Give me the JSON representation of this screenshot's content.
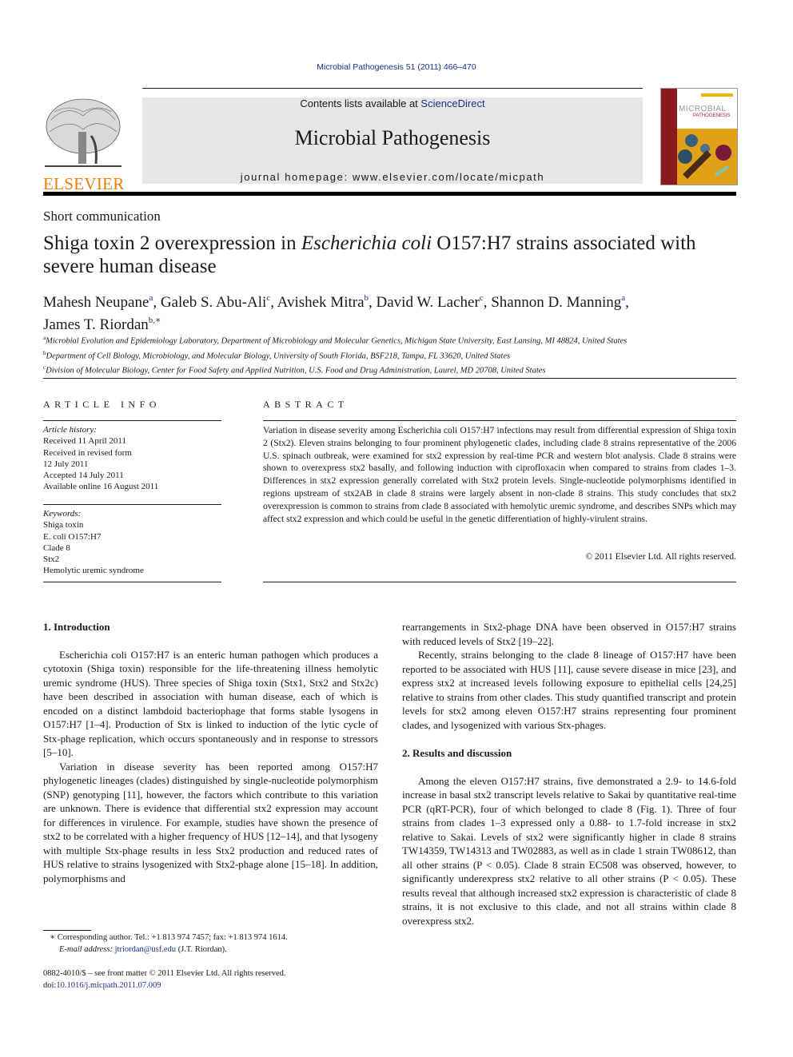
{
  "header": {
    "citation": "Microbial Pathogenesis 51 (2011) 466–470",
    "contents_prefix": "Contents lists available at ",
    "contents_link": "ScienceDirect",
    "journal_title": "Microbial Pathogenesis",
    "homepage": "journal homepage: www.elsevier.com/locate/micpath",
    "publisher_logo_text": "ELSEVIER",
    "cover_title_line1": "MICROBIAL",
    "cover_title_line2": "PATHOGENESIS",
    "colors": {
      "publisher_orange": "#f07d00",
      "link_blue": "#1e2f8a",
      "banner_gray": "#e6e6e6",
      "cover_red": "#8b1a1f"
    }
  },
  "article": {
    "section_type": "Short communication",
    "title_part1": "Shiga toxin 2 overexpression in ",
    "title_italic": "Escherichia coli",
    "title_part2": " O157:H7 strains associated with severe human disease",
    "authors": [
      {
        "name": "Mahesh Neupane",
        "sup": "a",
        "sep": ", "
      },
      {
        "name": "Galeb S. Abu-Ali",
        "sup": "c",
        "sep": ", "
      },
      {
        "name": "Avishek Mitra",
        "sup": "b",
        "sep": ", "
      },
      {
        "name": "David W. Lacher",
        "sup": "c",
        "sep": ", "
      },
      {
        "name": "Shannon D. Manning",
        "sup": "a",
        "sep": ","
      },
      {
        "name": "James T. Riordan",
        "sup": "b,∗",
        "sep": ""
      }
    ],
    "affiliations": [
      {
        "key": "a",
        "text": "Microbial Evolution and Epidemiology Laboratory, Department of Microbiology and Molecular Genetics, Michigan State University, East Lansing, MI 48824, United States"
      },
      {
        "key": "b",
        "text": "Department of Cell Biology, Microbiology, and Molecular Biology, University of South Florida, BSF218, Tampa, FL 33620, United States"
      },
      {
        "key": "c",
        "text": "Division of Molecular Biology, Center for Food Safety and Applied Nutrition, U.S. Food and Drug Administration, Laurel, MD 20708, United States"
      }
    ]
  },
  "article_info": {
    "heading": "ARTICLE INFO",
    "history_label": "Article history:",
    "history": [
      "Received 11 April 2011",
      "Received in revised form",
      "12 July 2011",
      "Accepted 14 July 2011",
      "Available online 16 August 2011"
    ],
    "keywords_label": "Keywords:",
    "keywords": [
      "Shiga toxin",
      "E. coli O157:H7",
      "Clade 8",
      "Stx2",
      "Hemolytic uremic syndrome"
    ]
  },
  "abstract": {
    "heading": "ABSTRACT",
    "text": "Variation in disease severity among Escherichia coli O157:H7 infections may result from differential expression of Shiga toxin 2 (Stx2). Eleven strains belonging to four prominent phylogenetic clades, including clade 8 strains representative of the 2006 U.S. spinach outbreak, were examined for stx2 expression by real-time PCR and western blot analysis. Clade 8 strains were shown to overexpress stx2 basally, and following induction with ciprofloxacin when compared to strains from clades 1–3. Differences in stx2 expression generally correlated with Stx2 protein levels. Single-nucleotide polymorphisms identified in regions upstream of stx2AB in clade 8 strains were largely absent in non-clade 8 strains. This study concludes that stx2 overexpression is common to strains from clade 8 associated with hemolytic uremic syndrome, and describes SNPs which may affect stx2 expression and which could be useful in the genetic differentiation of highly-virulent strains.",
    "copyright": "© 2011 Elsevier Ltd. All rights reserved."
  },
  "body": {
    "sec1_heading": "1.  Introduction",
    "sec1_p1": "Escherichia coli O157:H7 is an enteric human pathogen which produces a cytotoxin (Shiga toxin) responsible for the life-threatening illness hemolytic uremic syndrome (HUS). Three species of Shiga toxin (Stx1, Stx2 and Stx2c) have been described in association with human disease, each of which is encoded on a distinct lambdoid bacteriophage that forms stable lysogens in O157:H7 [1–4]. Production of Stx is linked to induction of the lytic cycle of Stx-phage replication, which occurs spontaneously and in response to stressors [5–10].",
    "sec1_p2": "Variation in disease severity has been reported among O157:H7 phylogenetic lineages (clades) distinguished by single-nucleotide polymorphism (SNP) genotyping [11], however, the factors which contribute to this variation are unknown. There is evidence that differential stx2 expression may account for differences in virulence. For example, studies have shown the presence of stx2 to be correlated with a higher frequency of HUS [12–14], and that lysogeny with multiple Stx-phage results in less Stx2 production and reduced rates of HUS relative to strains lysogenized with Stx2-phage alone [15–18]. In addition, polymorphisms and",
    "sec1_p2_cont": "rearrangements in Stx2-phage DNA have been observed in O157:H7 strains with reduced levels of Stx2 [19–22].",
    "sec1_p3": "Recently, strains belonging to the clade 8 lineage of O157:H7 have been reported to be associated with HUS [11], cause severe disease in mice [23], and express stx2 at increased levels following exposure to epithelial cells [24,25] relative to strains from other clades. This study quantified transcript and protein levels for stx2 among eleven O157:H7 strains representing four prominent clades, and lysogenized with various Stx-phages.",
    "sec2_heading": "2.  Results and discussion",
    "sec2_p1": "Among the eleven O157:H7 strains, five demonstrated a 2.9- to 14.6-fold increase in basal stx2 transcript levels relative to Sakai by quantitative real-time PCR (qRT-PCR), four of which belonged to clade 8 (Fig. 1). Three of four strains from clades 1–3 expressed only a 0.88- to 1.7-fold increase in stx2 relative to Sakai. Levels of stx2 were significantly higher in clade 8 strains TW14359, TW14313 and TW02883, as well as in clade 1 strain TW08612, than all other strains (P < 0.05). Clade 8 strain EC508 was observed, however, to significantly underexpress stx2 relative to all other strains (P < 0.05). These results reveal that although increased stx2 expression is characteristic of clade 8 strains, it is not exclusive to this clade, and not all strains within clade 8 overexpress stx2."
  },
  "footnotes": {
    "corresponding": "∗  Corresponding author. Tel.: +1 813 974 7457; fax: +1 813 974 1614.",
    "email_label": "E-mail address: ",
    "email": "jtriordan@usf.edu",
    "email_suffix": " (J.T. Riordan).",
    "front_matter": "0882-4010/$ – see front matter © 2011 Elsevier Ltd. All rights reserved.",
    "doi_label": "doi:",
    "doi": "10.1016/j.micpath.2011.07.009"
  }
}
